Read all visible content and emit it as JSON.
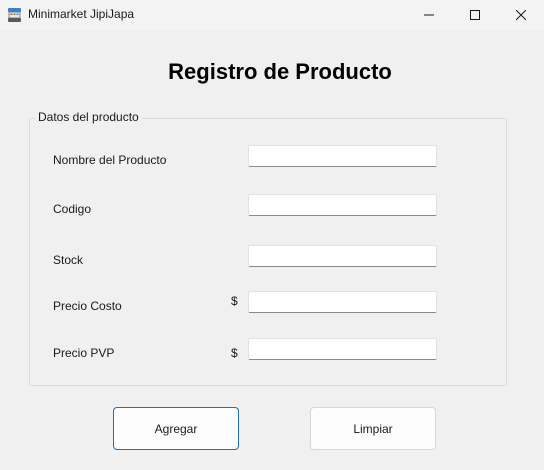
{
  "window": {
    "title": "Minimarket JipiJapa",
    "app_icon": "cash-register-icon",
    "controls": [
      "minimize-icon",
      "maximize-icon",
      "close-icon"
    ]
  },
  "form": {
    "heading": "Registro de Producto",
    "group_label": "Datos del producto",
    "fields": {
      "nombre": {
        "label": "Nombre del Producto",
        "value": ""
      },
      "codigo": {
        "label": "Codigo",
        "value": ""
      },
      "stock": {
        "label": "Stock",
        "value": ""
      },
      "precio_costo": {
        "label": "Precio Costo",
        "currency": "$",
        "value": ""
      },
      "precio_pvp": {
        "label": "Precio PVP",
        "currency": "$",
        "value": ""
      }
    }
  },
  "actions": {
    "add_label": "Agregar",
    "clear_label": "Limpiar"
  },
  "colors": {
    "background": "#f0f0f0",
    "primary_border": "#1f6fb5"
  }
}
